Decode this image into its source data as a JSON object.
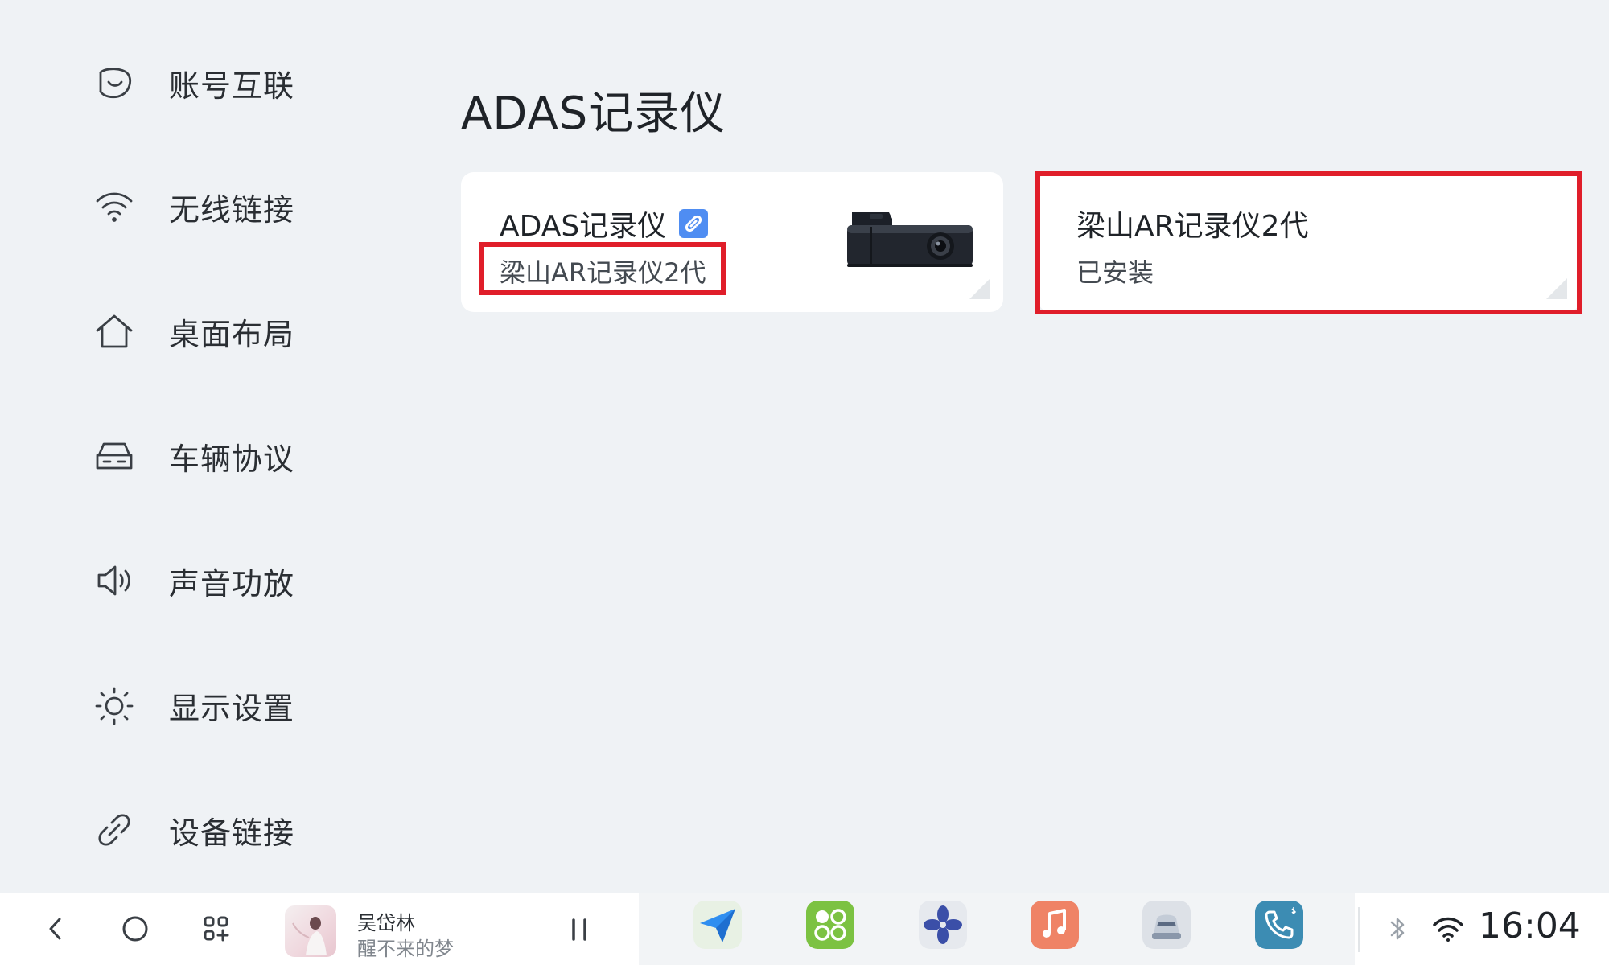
{
  "sidebar": {
    "items": [
      {
        "label": "账号互联",
        "icon": "account-link-icon"
      },
      {
        "label": "无线链接",
        "icon": "wifi-icon"
      },
      {
        "label": "桌面布局",
        "icon": "home-icon"
      },
      {
        "label": "车辆协议",
        "icon": "car-icon"
      },
      {
        "label": "声音功放",
        "icon": "speaker-icon"
      },
      {
        "label": "显示设置",
        "icon": "brightness-icon"
      },
      {
        "label": "设备链接",
        "icon": "link-icon"
      }
    ]
  },
  "main": {
    "title": "ADAS记录仪",
    "cards": [
      {
        "name": "ADAS记录仪",
        "subtitle": "梁山AR记录仪2代",
        "badge": "link-icon",
        "image": "dashcam-image"
      },
      {
        "name": "梁山AR记录仪2代",
        "subtitle": "已安装"
      }
    ]
  },
  "taskbar": {
    "media": {
      "artist": "吴岱林",
      "song": "醒不来的梦"
    },
    "apps": [
      "navigation-app",
      "apps-grid-app",
      "fan-app",
      "music-app",
      "car-app",
      "phone-app"
    ],
    "clock": "16:04"
  },
  "colors": {
    "highlight": "#e01e2a",
    "accent": "#4f8df2",
    "background": "#eff2f5"
  }
}
